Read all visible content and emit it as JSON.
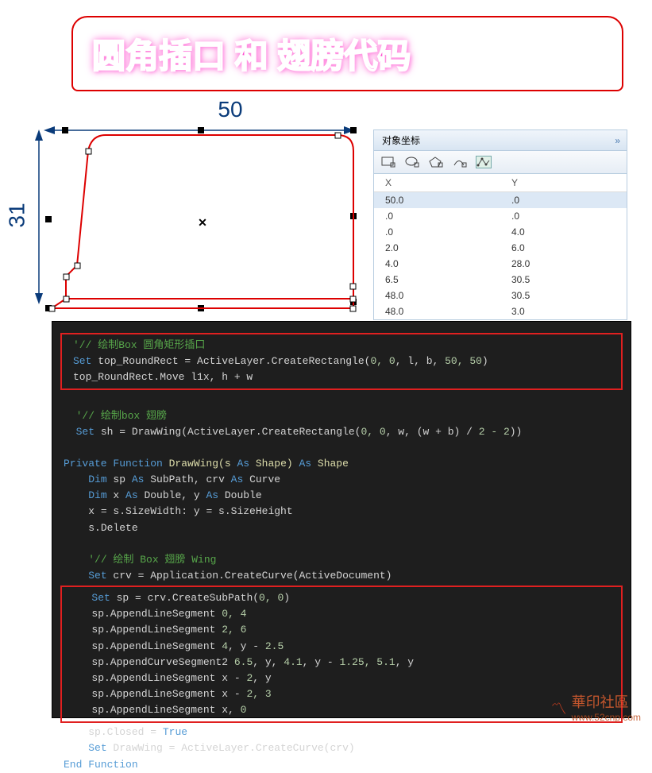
{
  "title": "圆角插口 和 翅膀代码",
  "dimensions": {
    "width_label": "50",
    "height_label": "31"
  },
  "coord_panel": {
    "title": "对象坐标",
    "columns": {
      "x": "X",
      "y": "Y"
    },
    "rows": [
      {
        "x": "50.0",
        "y": ".0"
      },
      {
        "x": ".0",
        "y": ".0"
      },
      {
        "x": ".0",
        "y": "4.0"
      },
      {
        "x": "2.0",
        "y": "6.0"
      },
      {
        "x": "4.0",
        "y": "28.0"
      },
      {
        "x": "6.5",
        "y": "30.5"
      },
      {
        "x": "48.0",
        "y": "30.5"
      },
      {
        "x": "48.0",
        "y": "3.0"
      }
    ],
    "selected_row": 0
  },
  "code": {
    "block1_comment": "'// 绘制Box 圆角矩形插口",
    "block1_line1a": "Set",
    "block1_line1b": " top_RoundRect = ActiveLayer.CreateRectangle(",
    "block1_line1c": "0, 0",
    "block1_line1d": ", l, b, ",
    "block1_line1e": "50, 50",
    "block1_line1f": ")",
    "block1_line2": "top_RoundRect.Move l1x, h + w",
    "block2_comment": "'// 绘制box 翅膀",
    "block2_line1a": "Set",
    "block2_line1b": " sh = DrawWing(ActiveLayer.CreateRectangle(",
    "block2_line1c": "0, 0",
    "block2_line1d": ", w, (w + b) / ",
    "block2_line1e": "2 - 2",
    "block2_line1f": "))",
    "fn_sig_a": "Private Function",
    "fn_sig_b": " DrawWing(s ",
    "fn_sig_c": "As",
    "fn_sig_d": " Shape) ",
    "fn_sig_e": "As",
    "fn_sig_f": " Shape",
    "dim1a": "Dim",
    "dim1b": " sp ",
    "dim1c": "As",
    "dim1d": " SubPath, crv ",
    "dim1e": "As",
    "dim1f": " Curve",
    "dim2a": "Dim",
    "dim2b": " x ",
    "dim2c": "As",
    "dim2d": " Double, y ",
    "dim2e": "As",
    "dim2f": " Double",
    "assign1": "x = s.SizeWidth: y = s.SizeHeight",
    "assign2": "s.Delete",
    "block3_comment": "'// 绘制 Box 翅膀 Wing",
    "crv_a": "Set",
    "crv_b": " crv = Application.CreateCurve(ActiveDocument)",
    "sp_a": "Set",
    "sp_b": " sp = crv.CreateSubPath(",
    "sp_c": "0, 0",
    "sp_d": ")",
    "seg1a": "sp.AppendLineSegment ",
    "seg1b": "0, 4",
    "seg2a": "sp.AppendLineSegment ",
    "seg2b": "2, 6",
    "seg3a": "sp.AppendLineSegment ",
    "seg3b": "4",
    "seg3c": ", y - ",
    "seg3d": "2.5",
    "seg4a": "sp.AppendCurveSegment2 ",
    "seg4b": "6.5",
    "seg4c": ", y, ",
    "seg4d": "4.1",
    "seg4e": ", y - ",
    "seg4f": "1.25, 5.1",
    "seg4g": ", y",
    "seg5a": "sp.AppendLineSegment x - ",
    "seg5b": "2",
    "seg5c": ", y",
    "seg6a": "sp.AppendLineSegment x - ",
    "seg6b": "2, 3",
    "seg7a": "sp.AppendLineSegment x, ",
    "seg7b": "0",
    "closed_a": "sp.Closed = ",
    "closed_b": "True",
    "ret_a": "Set",
    "ret_b": " DrawWing = ActiveLayer.CreateCurve(crv)",
    "end_fn": "End Function"
  },
  "watermark": {
    "text": "華印社區",
    "url": "www.52cnp.com"
  }
}
